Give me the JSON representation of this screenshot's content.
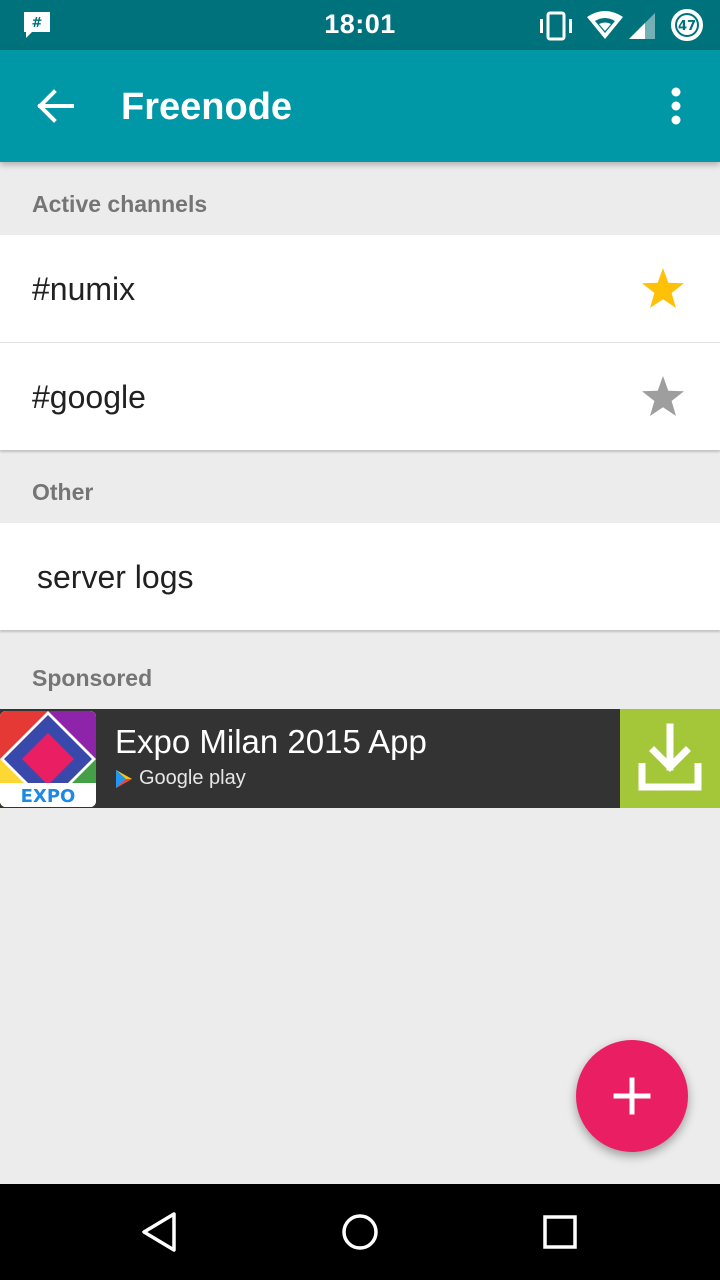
{
  "status_bar": {
    "time": "18:01",
    "battery": "47",
    "icons": [
      "notification-icon",
      "vibrate-icon",
      "wifi-icon",
      "signal-icon",
      "battery-icon"
    ]
  },
  "app_bar": {
    "title": "Freenode"
  },
  "sections": {
    "active": {
      "header": "Active channels",
      "items": [
        {
          "label": "#numix",
          "starred": true
        },
        {
          "label": "#google",
          "starred": false
        }
      ]
    },
    "other": {
      "header": "Other",
      "items": [
        {
          "label": "server logs"
        }
      ]
    },
    "sponsored": {
      "header": "Sponsored",
      "ad": {
        "title": "Expo Milan 2015 App",
        "store": "Google play",
        "logo_text": "EXPO"
      }
    }
  },
  "colors": {
    "status_bar": "#00727c",
    "app_bar": "#0097a7",
    "star_active": "#ffc107",
    "star_inactive": "#9e9e9e",
    "fab": "#e91e63",
    "download": "#a4c639"
  }
}
